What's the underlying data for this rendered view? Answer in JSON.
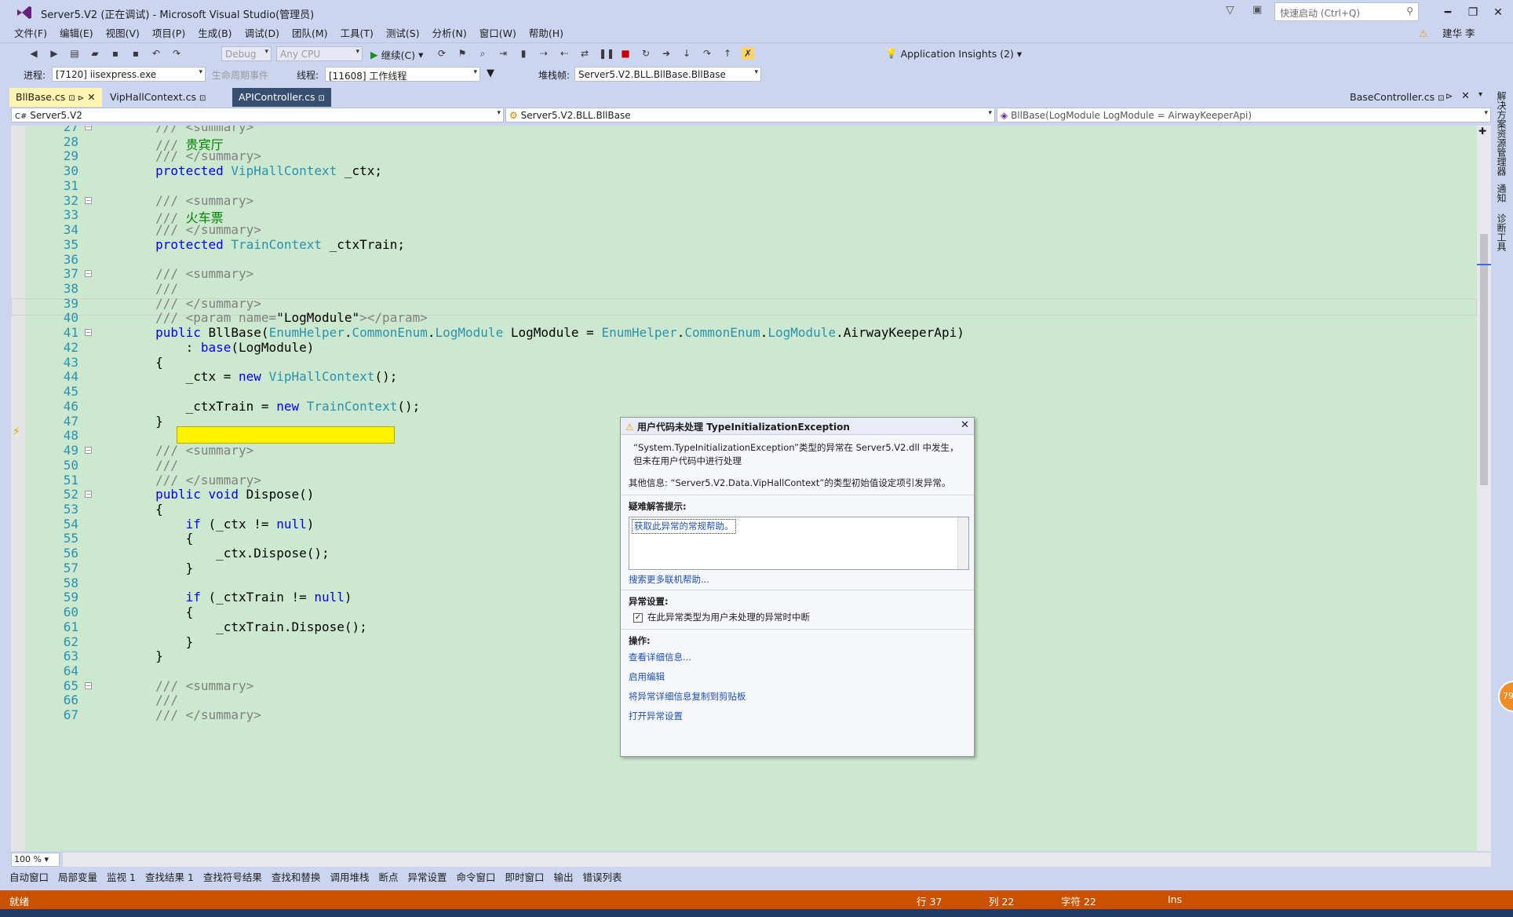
{
  "window": {
    "title": "Server5.V2 (正在调试) - Microsoft Visual Studio(管理员)",
    "quick_launch_placeholder": "快速启动 (Ctrl+Q)",
    "user": "建华 李"
  },
  "menu": [
    "文件(F)",
    "编辑(E)",
    "视图(V)",
    "项目(P)",
    "生成(B)",
    "调试(D)",
    "团队(M)",
    "工具(T)",
    "测试(S)",
    "分析(N)",
    "窗口(W)",
    "帮助(H)"
  ],
  "toolbar": {
    "config": "Debug",
    "platform": "Any CPU",
    "continue": "继续(C)",
    "insights": "Application Insights (2)"
  },
  "debug_bar": {
    "process_label": "进程:",
    "process": "[7120] iisexpress.exe",
    "lifecycle": "生命周期事件",
    "thread_label": "线程:",
    "thread": "[11608] 工作线程",
    "stack_label": "堆栈帧:",
    "stack": "Server5.V2.BLL.BllBase.BllBase"
  },
  "tabs": [
    {
      "label": "BllBase.cs"
    },
    {
      "label": "VipHallContext.cs"
    },
    {
      "label": "APIController.cs"
    },
    {
      "label": "BaseController.cs"
    }
  ],
  "nav": {
    "project": "Server5.V2",
    "class": "Server5.V2.BLL.BllBase",
    "member": "BllBase(LogModule LogModule = AirwayKeeperApi)"
  },
  "code_lines": [
    {
      "n": "27",
      "text": "        /// <summary>"
    },
    {
      "n": "28",
      "text": "        /// 贵宾厅"
    },
    {
      "n": "29",
      "text": "        /// </summary>"
    },
    {
      "n": "30",
      "text": "        protected VipHallContext _ctx;"
    },
    {
      "n": "31",
      "text": ""
    },
    {
      "n": "32",
      "text": "        /// <summary>"
    },
    {
      "n": "33",
      "text": "        /// 火车票"
    },
    {
      "n": "34",
      "text": "        /// </summary>"
    },
    {
      "n": "35",
      "text": "        protected TrainContext _ctxTrain;"
    },
    {
      "n": "36",
      "text": ""
    },
    {
      "n": "37",
      "text": "        /// <summary>"
    },
    {
      "n": "38",
      "text": "        ///"
    },
    {
      "n": "39",
      "text": "        /// </summary>"
    },
    {
      "n": "40",
      "text": "        /// <param name=\"LogModule\"></param>"
    },
    {
      "n": "41",
      "text": "        public BllBase(EnumHelper.CommonEnum.LogModule LogModule = EnumHelper.CommonEnum.LogModule.AirwayKeeperApi)"
    },
    {
      "n": "42",
      "text": "            : base(LogModule)"
    },
    {
      "n": "43",
      "text": "        {"
    },
    {
      "n": "44",
      "text": "            _ctx = new VipHallContext();"
    },
    {
      "n": "45",
      "text": ""
    },
    {
      "n": "46",
      "text": "            _ctxTrain = new TrainContext();"
    },
    {
      "n": "47",
      "text": "        }"
    },
    {
      "n": "48",
      "text": ""
    },
    {
      "n": "49",
      "text": "        /// <summary>"
    },
    {
      "n": "50",
      "text": "        ///"
    },
    {
      "n": "51",
      "text": "        /// </summary>"
    },
    {
      "n": "52",
      "text": "        public void Dispose()"
    },
    {
      "n": "53",
      "text": "        {"
    },
    {
      "n": "54",
      "text": "            if (_ctx != null)"
    },
    {
      "n": "55",
      "text": "            {"
    },
    {
      "n": "56",
      "text": "                _ctx.Dispose();"
    },
    {
      "n": "57",
      "text": "            }"
    },
    {
      "n": "58",
      "text": ""
    },
    {
      "n": "59",
      "text": "            if (_ctxTrain != null)"
    },
    {
      "n": "60",
      "text": "            {"
    },
    {
      "n": "61",
      "text": "                _ctxTrain.Dispose();"
    },
    {
      "n": "62",
      "text": "            }"
    },
    {
      "n": "63",
      "text": "        }"
    },
    {
      "n": "64",
      "text": ""
    },
    {
      "n": "65",
      "text": "        /// <summary>"
    },
    {
      "n": "66",
      "text": "        ///"
    },
    {
      "n": "67",
      "text": "        /// </summary>"
    }
  ],
  "exception": {
    "title": "用户代码未处理 TypeInitializationException",
    "message": "“System.TypeInitializationException”类型的异常在 Server5.V2.dll 中发生，但未在用户代码中进行处理",
    "extra": "其他信息: “Server5.V2.Data.VipHallContext”的类型初始值设定项引发异常。",
    "hints_label": "疑难解答提示:",
    "hint_link": "获取此异常的常规帮助。",
    "search_link": "搜索更多联机帮助...",
    "settings_label": "异常设置:",
    "checkbox_label": "在此异常类型为用户未处理的异常时中断",
    "actions_label": "操作:",
    "actions": [
      "查看详细信息...",
      "启用编辑",
      "将异常详细信息复制到剪贴板",
      "打开异常设置"
    ]
  },
  "zoom": "100 %",
  "right_strip": [
    "解决方案资源管理器",
    "通知",
    "诊断工具"
  ],
  "bottom_tabs": [
    "自动窗口",
    "局部变量",
    "监视 1",
    "查找结果 1",
    "查找符号结果",
    "查找和替换",
    "调用堆栈",
    "断点",
    "异常设置",
    "命令窗口",
    "即时窗口",
    "输出",
    "错误列表"
  ],
  "status": {
    "state": "就绪",
    "row": "行 37",
    "col": "列 22",
    "char": "字符 22",
    "mode": "Ins"
  },
  "badge": "79",
  "colors": {
    "accent": "#ca5100",
    "editor_bg": "#cce8cf",
    "highlight": "#fff200"
  }
}
